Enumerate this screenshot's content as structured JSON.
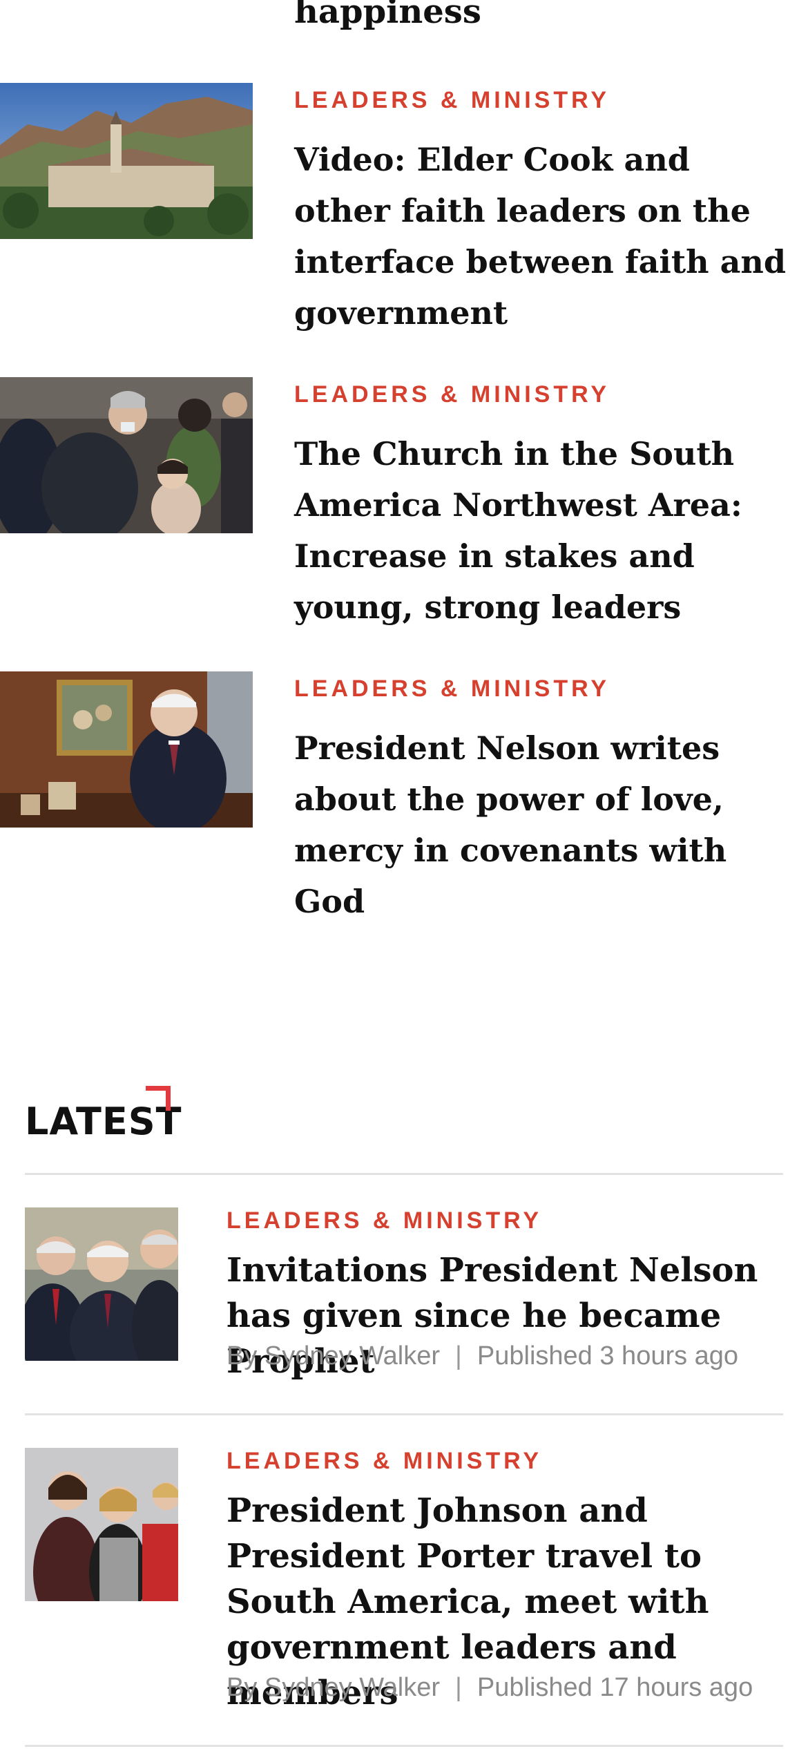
{
  "previous_story_fragment": "happiness",
  "related_stories": [
    {
      "category": "LEADERS & MINISTRY",
      "headline": "Video: Elder Cook and other faith leaders on the interface between faith and government",
      "image": "campus-mountains-photo"
    },
    {
      "category": "LEADERS & MINISTRY",
      "headline": "The Church in the South America Northwest Area: Increase in stakes and young, strong leaders",
      "image": "leader-greeting-child-photo"
    },
    {
      "category": "LEADERS & MINISTRY",
      "headline": "President Nelson writes about the power of love, mercy in covenants with God",
      "image": "president-portrait-office-photo"
    }
  ],
  "latest": {
    "title": "LATEST",
    "accent_color": "#e23a3f",
    "items": [
      {
        "category": "LEADERS & MINISTRY",
        "headline": "Invitations President Nelson has given since he became Prophet",
        "author": "By Sydney Walker",
        "separator": "|",
        "published": "Published 3 hours ago",
        "image": "three-leaders-photo"
      },
      {
        "category": "LEADERS & MINISTRY",
        "headline": "President Johnson and President Porter travel to South America, meet with government leaders and members",
        "author": "By Sydney Walker",
        "separator": "|",
        "published": "Published 17 hours ago",
        "image": "women-leaders-photo"
      }
    ]
  },
  "colors": {
    "category": "#d5402f",
    "headline": "#111111",
    "byline": "#8a8a8a",
    "divider": "#e2e2e2"
  }
}
